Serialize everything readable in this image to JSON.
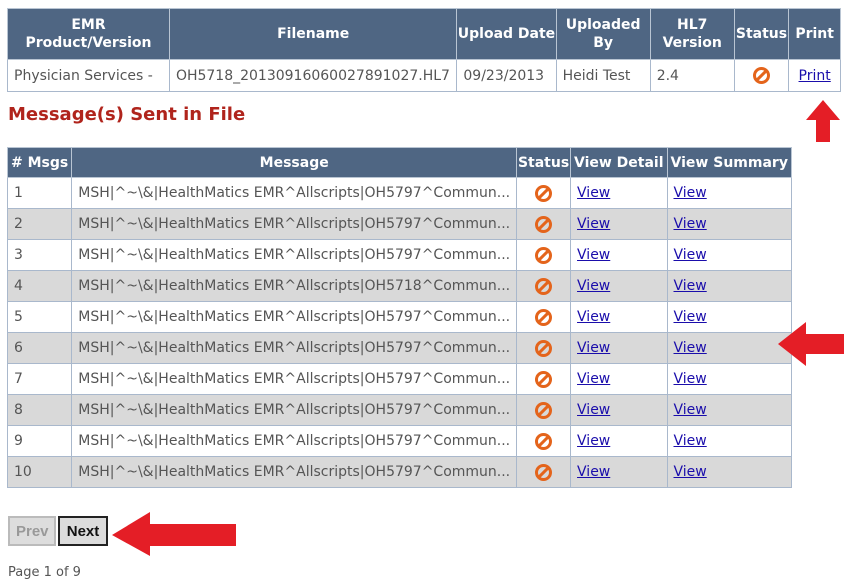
{
  "file_table": {
    "headers": [
      "EMR Product/Version",
      "Filename",
      "Upload Date",
      "Uploaded By",
      "HL7 Version",
      "Status",
      "Print"
    ],
    "row": {
      "product": "Physician Services -",
      "filename": "OH5718_20130916060027891027.HL7",
      "upload_date": "09/23/2013",
      "uploaded_by": "Heidi Test",
      "hl7_version": "2.4",
      "status_icon": "error-ban-icon",
      "print_link": "Print"
    }
  },
  "section_title": "Message(s) Sent in File",
  "messages_table": {
    "headers": [
      "# Msgs",
      "Message",
      "Status",
      "View Detail",
      "View Summary"
    ],
    "rows": [
      {
        "num": "1",
        "message": "MSH|^~\\&|HealthMatics EMR^Allscripts|OH5797^Commun...",
        "detail": "View",
        "summary": "View"
      },
      {
        "num": "2",
        "message": "MSH|^~\\&|HealthMatics EMR^Allscripts|OH5797^Commun...",
        "detail": "View",
        "summary": "View"
      },
      {
        "num": "3",
        "message": "MSH|^~\\&|HealthMatics EMR^Allscripts|OH5797^Commun...",
        "detail": "View",
        "summary": "View"
      },
      {
        "num": "4",
        "message": "MSH|^~\\&|HealthMatics EMR^Allscripts|OH5718^Commun...",
        "detail": "View",
        "summary": "View"
      },
      {
        "num": "5",
        "message": "MSH|^~\\&|HealthMatics EMR^Allscripts|OH5797^Commun...",
        "detail": "View",
        "summary": "View"
      },
      {
        "num": "6",
        "message": "MSH|^~\\&|HealthMatics EMR^Allscripts|OH5797^Commun...",
        "detail": "View",
        "summary": "View"
      },
      {
        "num": "7",
        "message": "MSH|^~\\&|HealthMatics EMR^Allscripts|OH5797^Commun...",
        "detail": "View",
        "summary": "View"
      },
      {
        "num": "8",
        "message": "MSH|^~\\&|HealthMatics EMR^Allscripts|OH5797^Commun...",
        "detail": "View",
        "summary": "View"
      },
      {
        "num": "9",
        "message": "MSH|^~\\&|HealthMatics EMR^Allscripts|OH5797^Commun...",
        "detail": "View",
        "summary": "View"
      },
      {
        "num": "10",
        "message": "MSH|^~\\&|HealthMatics EMR^Allscripts|OH5797^Commun...",
        "detail": "View",
        "summary": "View"
      }
    ]
  },
  "pager": {
    "prev_label": "Prev",
    "next_label": "Next",
    "page_info": "Page 1 of 9"
  },
  "colors": {
    "header_bg": "#4f6683",
    "title_red": "#b0241c",
    "status_orange": "#e4641b",
    "arrow_red": "#e41e26"
  }
}
